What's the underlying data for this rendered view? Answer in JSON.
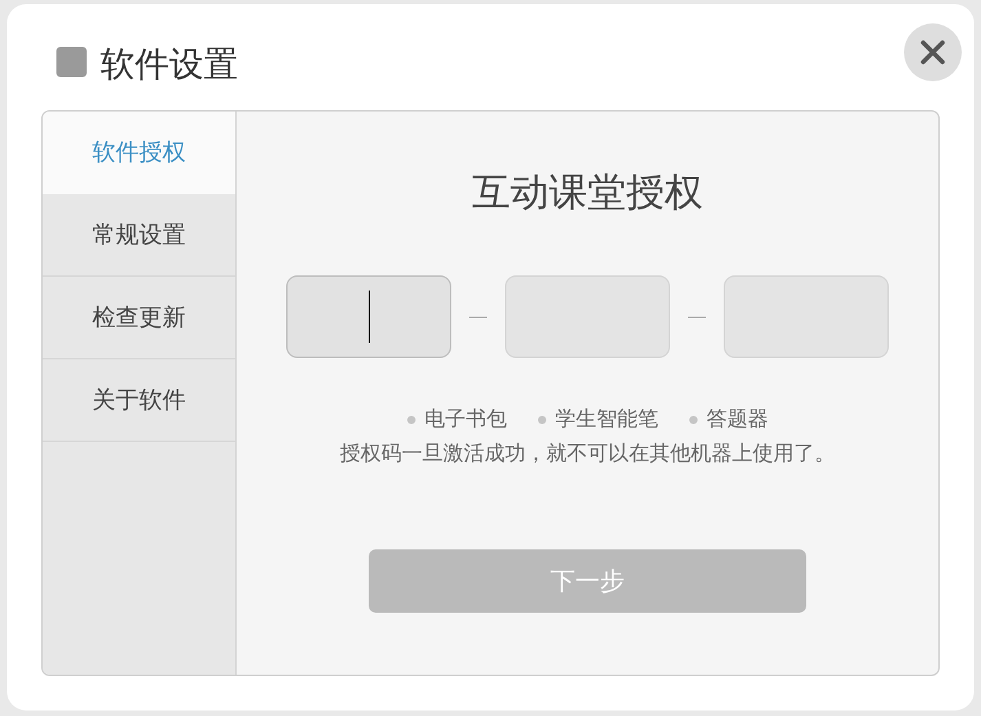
{
  "window": {
    "title": "软件设置"
  },
  "sidebar": {
    "items": [
      {
        "label": "软件授权",
        "selected": true
      },
      {
        "label": "常规设置",
        "selected": false
      },
      {
        "label": "检查更新",
        "selected": false
      },
      {
        "label": "关于软件",
        "selected": false
      }
    ]
  },
  "content": {
    "heading": "互动课堂授权",
    "code_fields": [
      {
        "focused": true
      },
      {
        "focused": false
      },
      {
        "focused": false
      }
    ],
    "devices": [
      "电子书包",
      "学生智能笔",
      "答题器"
    ],
    "note": "授权码一旦激活成功，就不可以在其他机器上使用了。",
    "next_button": {
      "label": "下一步",
      "disabled": true
    }
  }
}
